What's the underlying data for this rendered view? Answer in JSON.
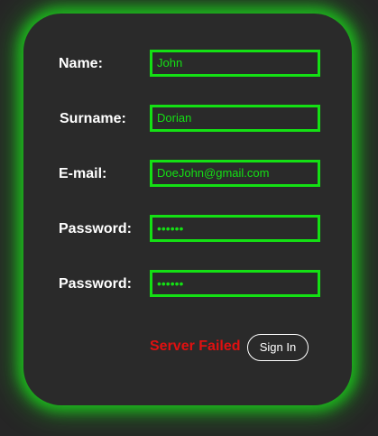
{
  "form": {
    "name_label": "Name:",
    "name_value": "John",
    "surname_label": "Surname:",
    "surname_value": "Dorian",
    "email_label": "E-mail:",
    "email_value": "DoeJohn@gmail.com",
    "password_label": "Password:",
    "password_value": "••••••",
    "password_confirm_label": "Password:",
    "password_confirm_value": "••••••",
    "status_text": "Server Failed",
    "submit_label": "Sign In"
  },
  "colors": {
    "accent": "#14e014",
    "error": "#e01010",
    "card_background": "#2a2a2a",
    "page_background": "#262626"
  }
}
